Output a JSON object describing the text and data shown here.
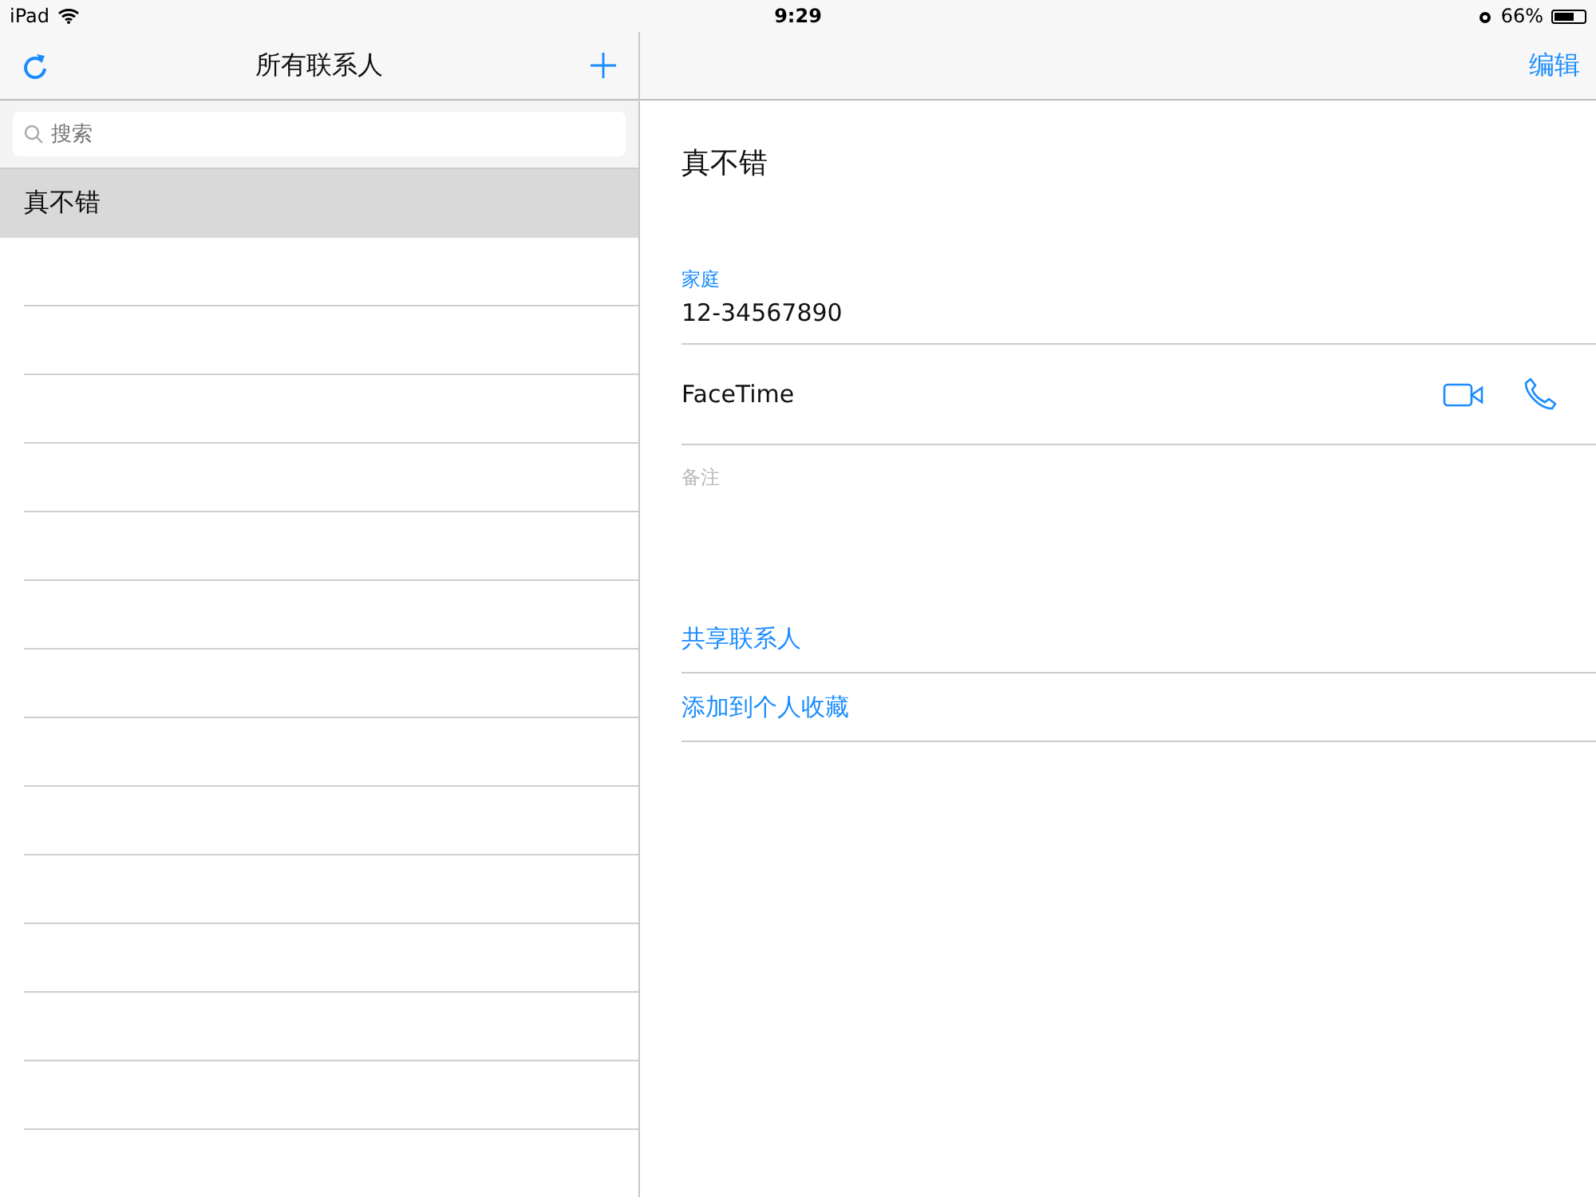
{
  "status_bar": {
    "device": "iPad",
    "time": "9:29",
    "battery": "66%"
  },
  "list_pane": {
    "title": "所有联系人",
    "search": {
      "placeholder": "搜索"
    },
    "contacts": [
      {
        "name": "真不错",
        "selected": true
      }
    ]
  },
  "detail_pane": {
    "edit_button": "编辑",
    "name": "真不错",
    "phone": {
      "label": "家庭",
      "value": "12-34567890"
    },
    "facetime": {
      "label": "FaceTime"
    },
    "notes": {
      "placeholder": "备注"
    },
    "actions": [
      "共享联系人",
      "添加到个人收藏"
    ]
  }
}
